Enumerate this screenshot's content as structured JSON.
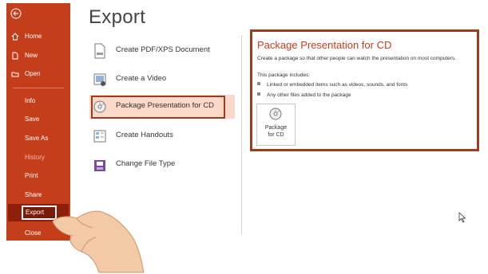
{
  "sidebar": {
    "items": [
      {
        "label": "Home",
        "icon": "home-icon"
      },
      {
        "label": "New",
        "icon": "new-doc-icon"
      },
      {
        "label": "Open",
        "icon": "folder-open-icon"
      },
      {
        "label": "Info"
      },
      {
        "label": "Save"
      },
      {
        "label": "Save As"
      },
      {
        "label": "History"
      },
      {
        "label": "Print"
      },
      {
        "label": "Share"
      },
      {
        "label": "Export"
      },
      {
        "label": "Close"
      }
    ],
    "accent": "#c43e1c"
  },
  "main": {
    "title": "Export",
    "options": [
      {
        "label": "Create PDF/XPS Document",
        "icon": "pdf-document-icon"
      },
      {
        "label": "Create a Video",
        "icon": "video-icon"
      },
      {
        "label": "Package Presentation for CD",
        "icon": "cd-icon"
      },
      {
        "label": "Create Handouts",
        "icon": "handouts-icon"
      },
      {
        "label": "Change File Type",
        "icon": "file-type-icon"
      }
    ]
  },
  "detail": {
    "title": "Package Presentation for CD",
    "description": "Create a package so that other people can watch the presentation on most computers.",
    "includes_heading": "This package includes:",
    "bullets": [
      "Linked or embedded items such as videos, sounds, and fonts",
      "Any other files added to the package"
    ],
    "button_label_line1": "Package",
    "button_label_line2": "for CD"
  }
}
